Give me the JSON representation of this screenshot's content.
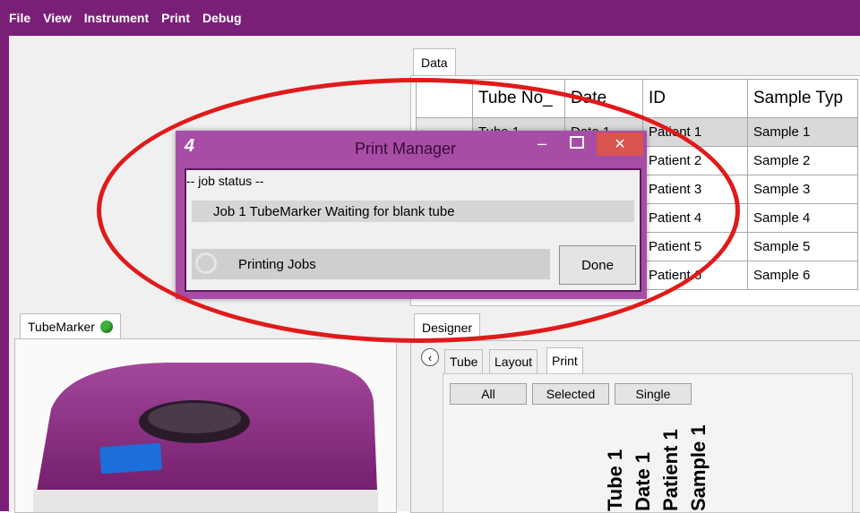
{
  "menu": [
    "File",
    "View",
    "Instrument",
    "Print",
    "Debug"
  ],
  "data_tab": {
    "label": "Data"
  },
  "grid": {
    "headers": [
      "Tube No_",
      "Date",
      "ID",
      "Sample Typ"
    ],
    "rows": [
      {
        "tube": "Tube 1",
        "date": "Date 1",
        "id": "Patient 1",
        "sample": "Sample 1"
      },
      {
        "tube": "",
        "date": "",
        "id": "Patient 2",
        "sample": "Sample 2"
      },
      {
        "tube": "",
        "date": "",
        "id": "Patient 3",
        "sample": "Sample 3"
      },
      {
        "tube": "",
        "date": "",
        "id": "Patient 4",
        "sample": "Sample 4"
      },
      {
        "tube": "",
        "date": "",
        "id": "Patient 5",
        "sample": "Sample 5"
      },
      {
        "tube": "",
        "date": "",
        "id": "Patient 6",
        "sample": "Sample 6"
      }
    ]
  },
  "tubemarker_tab": {
    "label": "TubeMarker",
    "status_color": "#3cb33c"
  },
  "designer": {
    "tab": "Designer",
    "subtabs": [
      "Tube",
      "Layout",
      "Print"
    ],
    "buttons": {
      "all": "All",
      "selected": "Selected",
      "single": "Single"
    },
    "label_preview": [
      "Tube 1",
      "Date 1",
      "Patient 1",
      "Sample 1"
    ]
  },
  "dialog": {
    "title": "Print Manager",
    "group_label": "-- job status --",
    "job_line": "Job 1 TubeMarker Waiting for blank tube",
    "status_text": "Printing Jobs",
    "done_label": "Done"
  },
  "colors": {
    "accent": "#7a1f78",
    "dialog": "#a84da6",
    "close": "#d9534f",
    "highlight": "#e01a1a"
  }
}
